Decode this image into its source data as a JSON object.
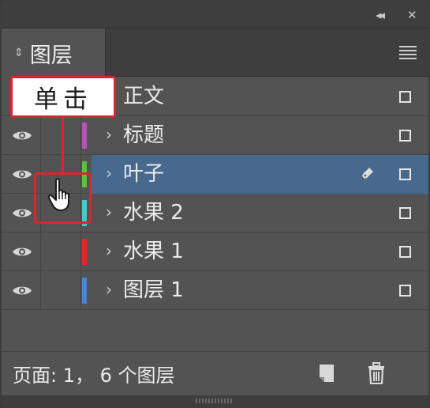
{
  "panel": {
    "tab_label": "图层",
    "status_text": "页面: 1， 6 个图层"
  },
  "icons": {
    "collapse": "double-chevron-left-icon",
    "close": "close-icon",
    "menu": "hamburger-menu-icon",
    "visibility": "eye-icon",
    "expand": "chevron-right-icon",
    "pen": "pen-icon",
    "new_layer": "new-layer-icon",
    "delete": "trash-icon",
    "cursor": "hand-pointer-icon"
  },
  "glyphs": {
    "collapse": "◂◂",
    "close": "✕",
    "sort": "⇕",
    "chevron": "›"
  },
  "layers": [
    {
      "name": "正文",
      "color": "#e05a3a",
      "visible": false,
      "expandable": false,
      "selected": false,
      "pen": false
    },
    {
      "name": "标题",
      "color": "#b455b6",
      "visible": true,
      "expandable": true,
      "selected": false,
      "pen": false
    },
    {
      "name": "叶子",
      "color": "#5cc23c",
      "visible": true,
      "expandable": true,
      "selected": true,
      "pen": true
    },
    {
      "name": "水果 2",
      "color": "#4cc7c9",
      "visible": true,
      "expandable": true,
      "selected": false,
      "pen": false
    },
    {
      "name": "水果 1",
      "color": "#e5262a",
      "visible": true,
      "expandable": true,
      "selected": false,
      "pen": false
    },
    {
      "name": "图层 1",
      "color": "#4a86d6",
      "visible": true,
      "expandable": true,
      "selected": false,
      "pen": false
    }
  ],
  "callout": {
    "label": "单击",
    "color": "#d8272d"
  }
}
